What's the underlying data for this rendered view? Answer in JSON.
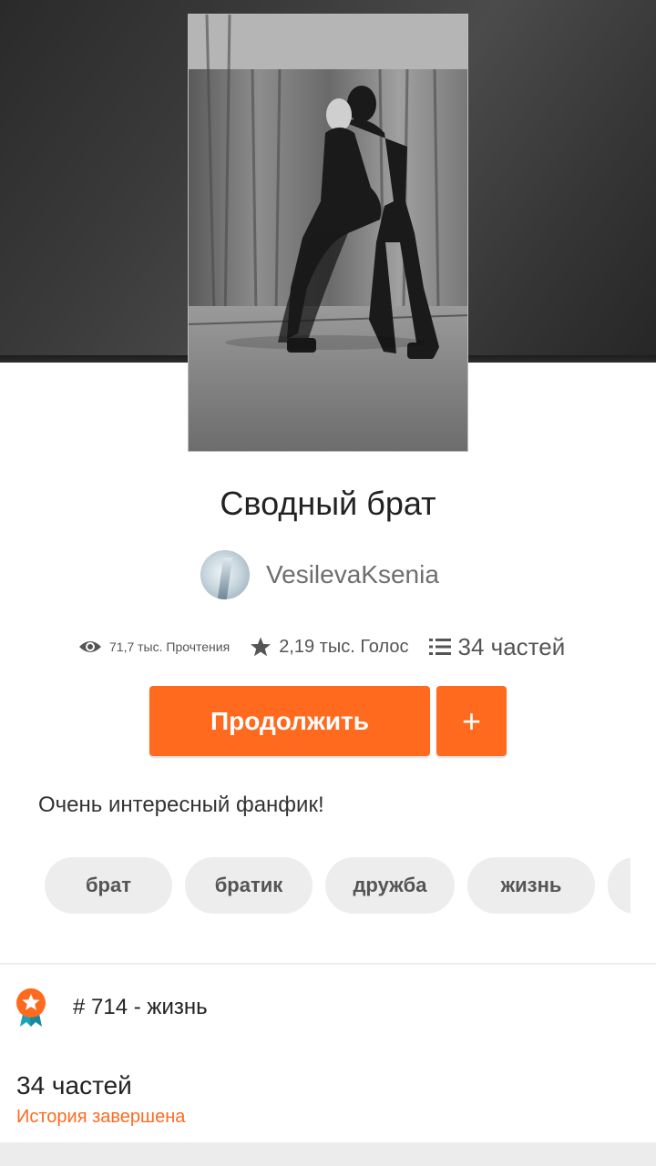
{
  "story": {
    "title": "Сводный брат",
    "author": "VesilevaKsenia",
    "description": "Очень интересный фанфик!"
  },
  "stats": {
    "reads": "71,7 тыс. Прочтения",
    "votes": "2,19 тыс. Голос",
    "parts": "34 частей"
  },
  "actions": {
    "continue_label": "Продолжить",
    "add_label": "+"
  },
  "tags": [
    "брат",
    "братик",
    "дружба",
    "жизнь",
    ""
  ],
  "ranking": {
    "text": "# 714 - жизнь"
  },
  "details": {
    "parts_count": "34 частей",
    "status": "История завершена"
  },
  "icons": {
    "reads": "eye-icon",
    "votes": "star-icon",
    "parts": "list-icon",
    "ranking": "badge-icon"
  },
  "colors": {
    "accent": "#ff6a1f",
    "tag_bg": "#ededed"
  }
}
